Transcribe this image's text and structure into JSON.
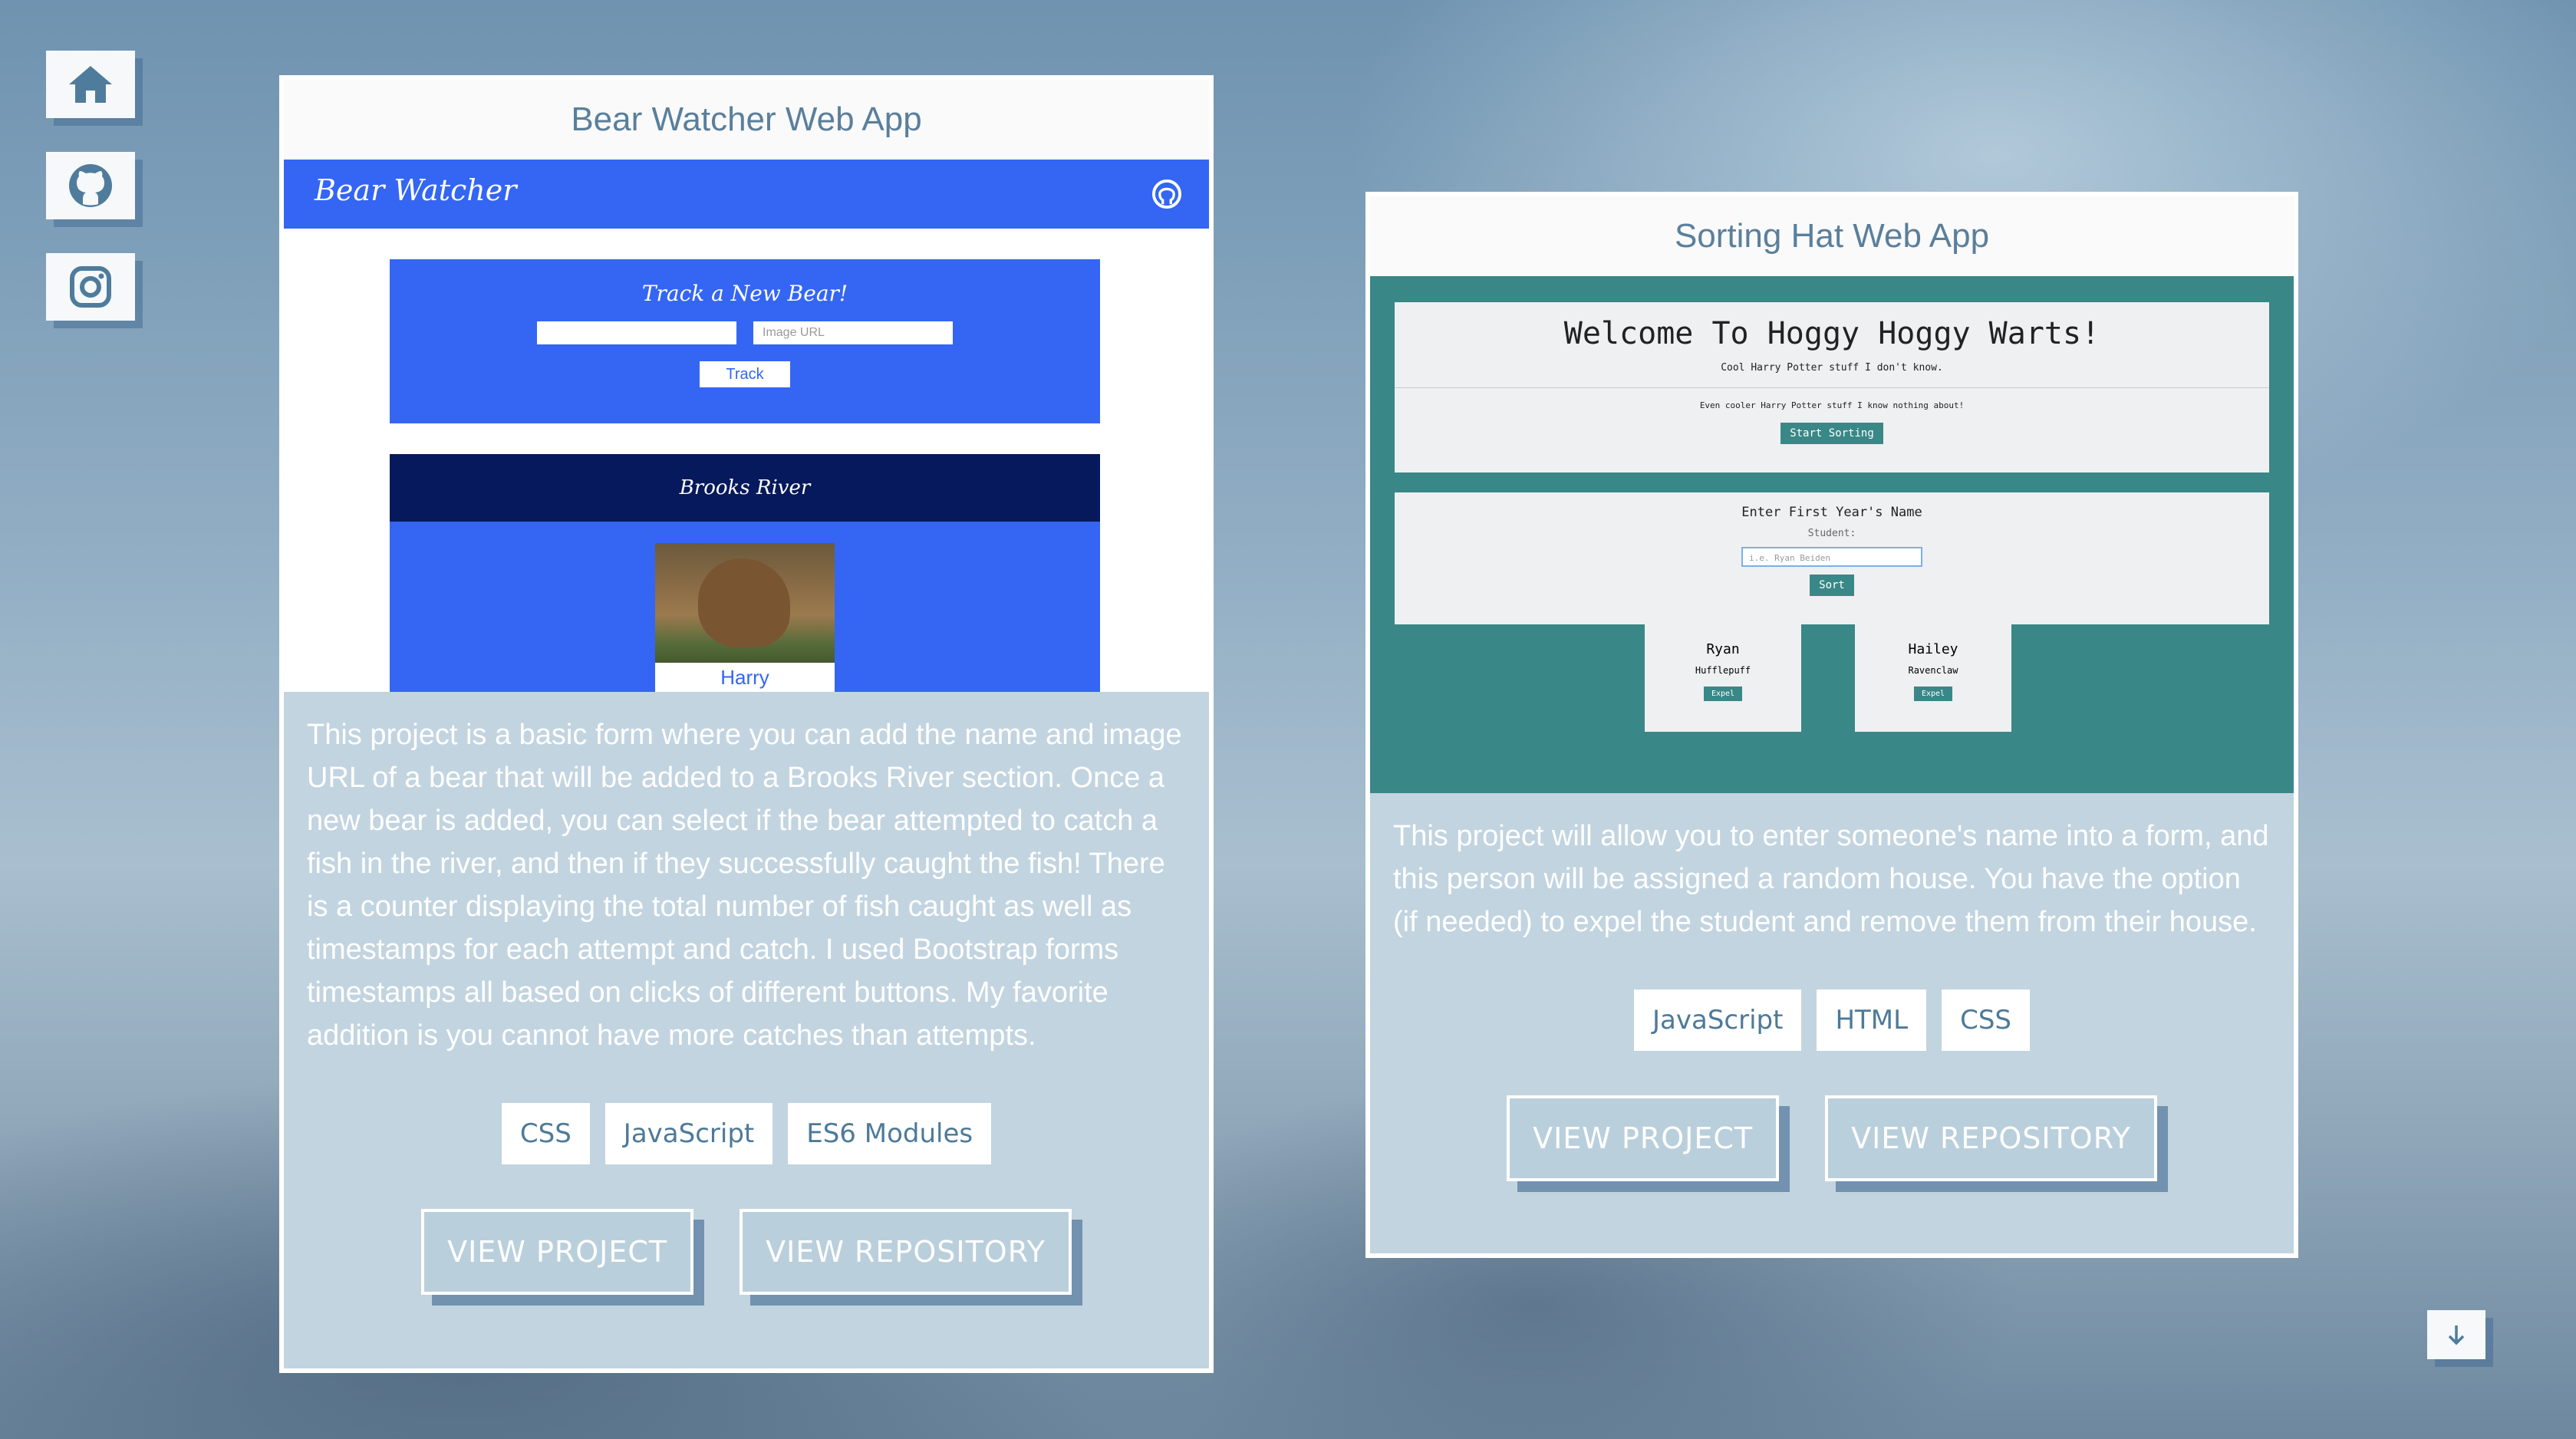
{
  "side_nav": {
    "items": [
      {
        "icon": "home-icon"
      },
      {
        "icon": "github-icon"
      },
      {
        "icon": "instagram-icon"
      }
    ]
  },
  "projects": [
    {
      "title": "Bear Watcher Web App",
      "screenshot": {
        "logo": "Bear Watcher",
        "form_title": "Track a New Bear!",
        "image_url_placeholder": "Image URL",
        "track_button": "Track",
        "section_title": "Brooks River",
        "bear_name": "Harry"
      },
      "description": "This project is a basic form where you can add the name and image URL of a bear that will be added to a Brooks River section. Once a new bear is added, you can select if the bear attempted to catch a fish in the river, and then if they successfully caught the fish! There is a counter displaying the total number of fish caught as well as timestamps for each attempt and catch. I used Bootstrap forms timestamps all based on clicks of different buttons. My favorite addition is you cannot have more catches than attempts.",
      "tags": [
        "CSS",
        "JavaScript",
        "ES6 Modules"
      ],
      "view_project": "VIEW PROJECT",
      "view_repository": "VIEW REPOSITORY"
    },
    {
      "title": "Sorting Hat Web App",
      "screenshot": {
        "heading": "Welcome To Hoggy Hoggy Warts!",
        "sub1": "Cool Harry Potter stuff I don't know.",
        "sub2": "Even cooler Harry Potter stuff I know nothing about!",
        "start_button": "Start Sorting",
        "form_title": "Enter First Year's Name",
        "student_label": "Student:",
        "input_placeholder": "i.e. Ryan Beiden",
        "sort_button": "Sort",
        "students": [
          {
            "name": "Ryan",
            "house": "Hufflepuff",
            "button": "Expel"
          },
          {
            "name": "Hailey",
            "house": "Ravenclaw",
            "button": "Expel"
          }
        ]
      },
      "description": "This project will allow you to enter someone's name into a form, and this person will be assigned a random house. You have the option (if needed) to expel the student and remove them from their house.",
      "tags": [
        "JavaScript",
        "HTML",
        "CSS"
      ],
      "view_project": "VIEW PROJECT",
      "view_repository": "VIEW REPOSITORY"
    }
  ],
  "scroll_down": {
    "icon": "arrow-down-icon"
  },
  "colors": {
    "accent": "#5a7f9c",
    "bear_blue": "#3466f3",
    "hat_teal": "#3a8787"
  }
}
